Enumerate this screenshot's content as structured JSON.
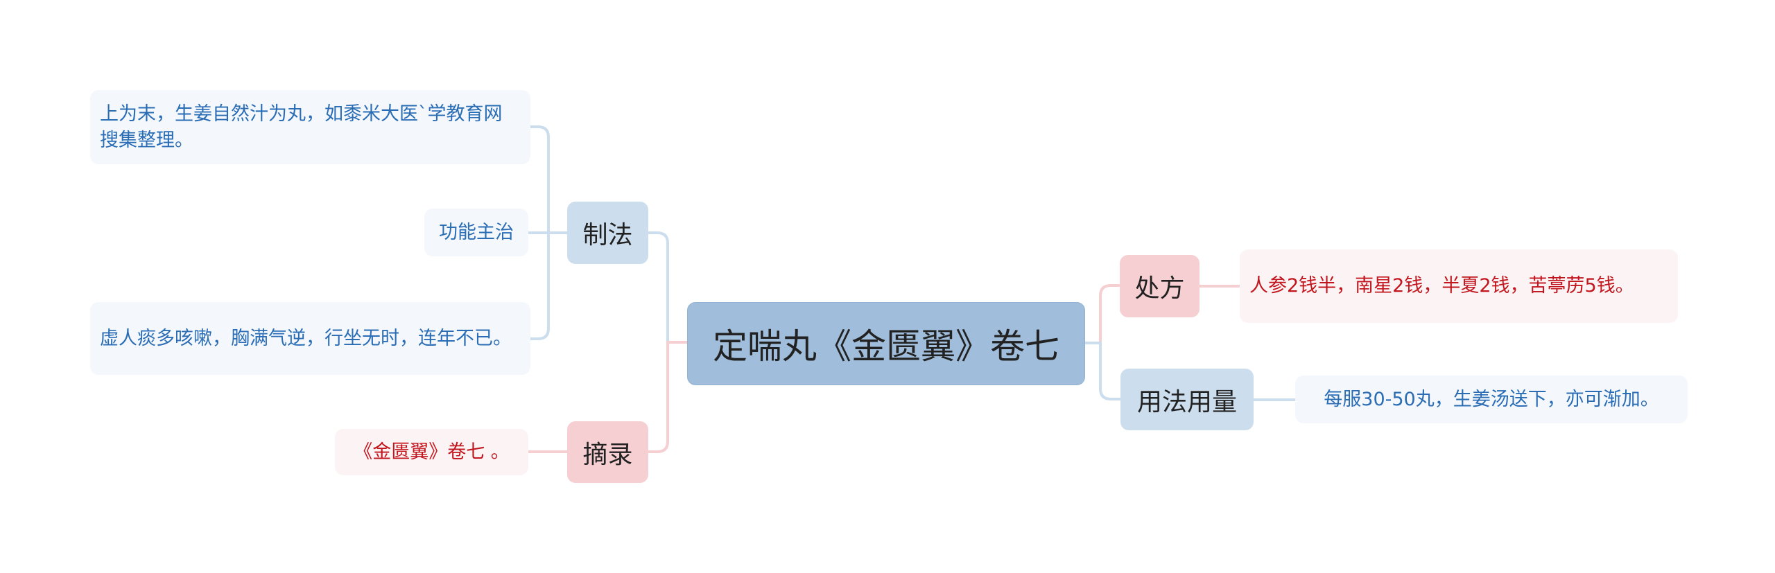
{
  "root": {
    "label": "定喘丸《金匮翼》卷七"
  },
  "branches": {
    "zhifa": {
      "label": "制法",
      "children": [
        "上为末，生姜自然汁为丸，如黍米大医`学教育网搜集整理。",
        "功能主治",
        "虚人痰多咳嗽，胸满气逆，行坐无时，连年不已。"
      ]
    },
    "zhailu": {
      "label": "摘录",
      "children": [
        "《金匮翼》卷七 。"
      ]
    },
    "chufang": {
      "label": "处方",
      "children": [
        "人参2钱半，南星2钱，半夏2钱，苦葶苈5钱。"
      ]
    },
    "yongfa": {
      "label": "用法用量",
      "children": [
        "每服30-50丸，生姜汤送下，亦可渐加。"
      ]
    }
  },
  "colors": {
    "root_fill": "#A0BEDB",
    "blue_branch": "#CCDDED",
    "pink_branch": "#F5CFD1",
    "blue_leaf": "#F4F8FC",
    "pink_leaf": "#FCF3F4",
    "blue_text": "#2A6DB5",
    "red_text": "#C2161E",
    "blue_line": "#CCDDED",
    "pink_line": "#F5CFD1"
  }
}
